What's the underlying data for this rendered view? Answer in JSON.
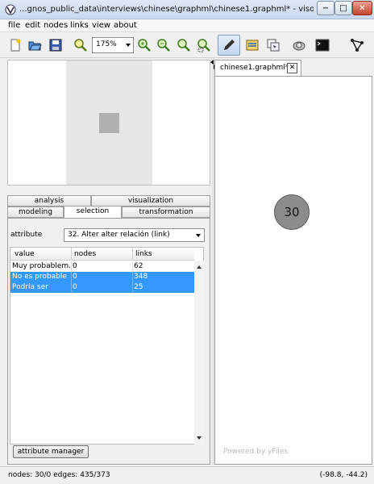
{
  "window": {
    "title": "...gnos_public_data\\interviews\\chinese\\graphml\\chinese1.graphml* - visone",
    "minimize_glyph": "−",
    "maximize_glyph": "□",
    "close_glyph": "✕"
  },
  "menu": {
    "items": [
      "file",
      "edit",
      "nodes",
      "links",
      "view",
      "about"
    ]
  },
  "toolbar": {
    "zoom_level": "175%",
    "icons": [
      "new-file-icon",
      "open-folder-icon",
      "save-icon",
      "zoom-fit-icon",
      "zoom-in-icon",
      "zoom-out-icon",
      "zoom-reset-icon",
      "zoom-selection-icon",
      "pencil-icon",
      "properties-icon",
      "layout-icon",
      "inspect-icon",
      "terminal-icon",
      "network-icon"
    ]
  },
  "tabs": {
    "row1": [
      "analysis",
      "visualization"
    ],
    "row2": [
      "modeling",
      "selection",
      "transformation"
    ],
    "active": "selection"
  },
  "selection_panel": {
    "attribute_label": "attribute",
    "attribute_value": "32. Alter alter relación (link)",
    "columns": [
      "value",
      "nodes",
      "links"
    ],
    "rows": [
      {
        "value": "Muy probablem...",
        "nodes": "0",
        "links": "62",
        "selected": false
      },
      {
        "value": "No es probable",
        "nodes": "0",
        "links": "348",
        "selected": true
      },
      {
        "value": "Podría ser",
        "nodes": "0",
        "links": "25",
        "selected": true
      }
    ],
    "attribute_manager_label": "attribute manager"
  },
  "document": {
    "tab_label": "chinese1.graphml*",
    "tab_close_glyph": "✕",
    "node_label": "30",
    "watermark": "Powered by yFiles"
  },
  "status": {
    "left": "nodes: 30/0  edges: 435/373",
    "right": "(-98.8, -44.2)"
  },
  "colors": {
    "selection": "#3399ff",
    "node_fill": "#8c8c8c"
  }
}
